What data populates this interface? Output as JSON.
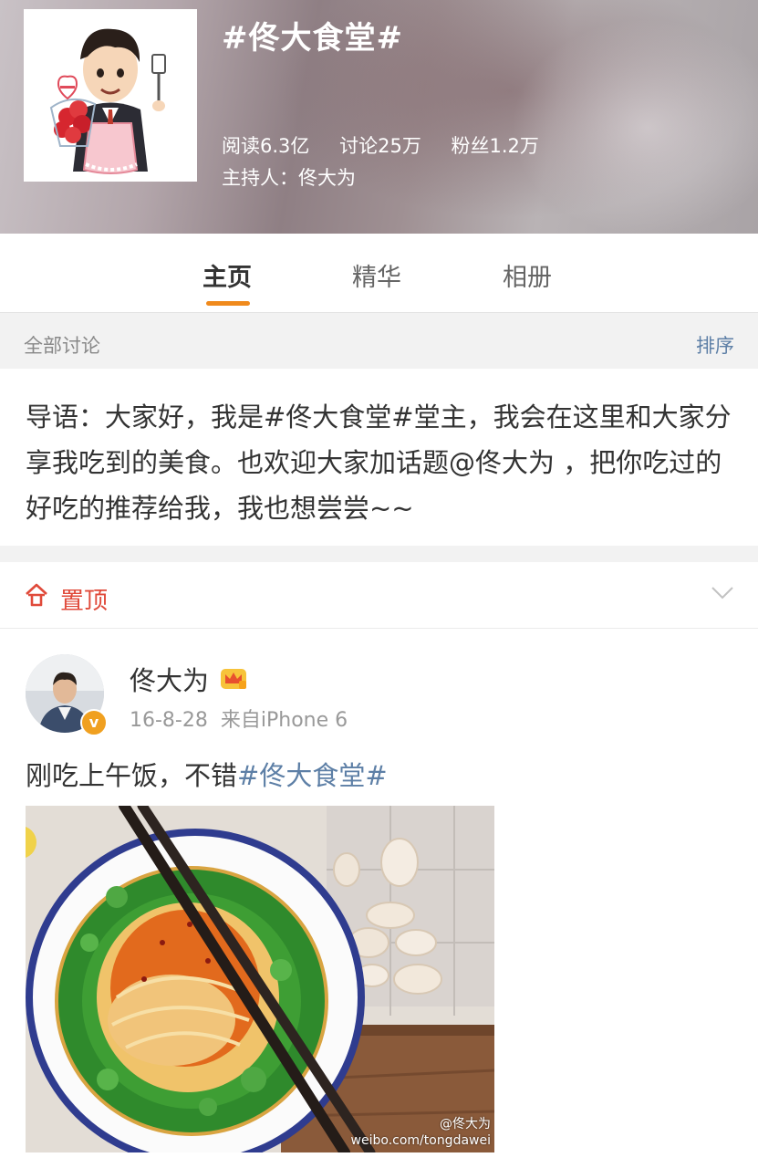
{
  "header": {
    "title": "#佟大食堂#",
    "stats": {
      "reads": "阅读6.3亿",
      "discussions": "讨论25万",
      "fans": "粉丝1.2万"
    },
    "host": "主持人：佟大为"
  },
  "tabs": [
    {
      "label": "主页",
      "active": true
    },
    {
      "label": "精华",
      "active": false
    },
    {
      "label": "相册",
      "active": false
    }
  ],
  "section": {
    "title": "全部讨论",
    "sort_label": "排序"
  },
  "intro": {
    "text": "导语：大家好，我是#佟大食堂#堂主，我会在这里和大家分享我吃到的美食。也欢迎大家加话题@佟大为 ，把你吃过的好吃的推荐给我，我也想尝尝~~"
  },
  "pinned": {
    "label": "置顶"
  },
  "post": {
    "username": "佟大为",
    "date": "16-8-28",
    "source": "来自iPhone 6",
    "text_prefix": "刚吃上午饭，不错",
    "text_tag": "#佟大食堂#",
    "watermark_name": "@佟大为",
    "watermark_url": "weibo.com/tongdawei"
  },
  "colors": {
    "accent": "#f08a1c",
    "link": "#5d7fa6",
    "pin_red": "#e04a3a",
    "vip_badge": "#f0a020"
  }
}
